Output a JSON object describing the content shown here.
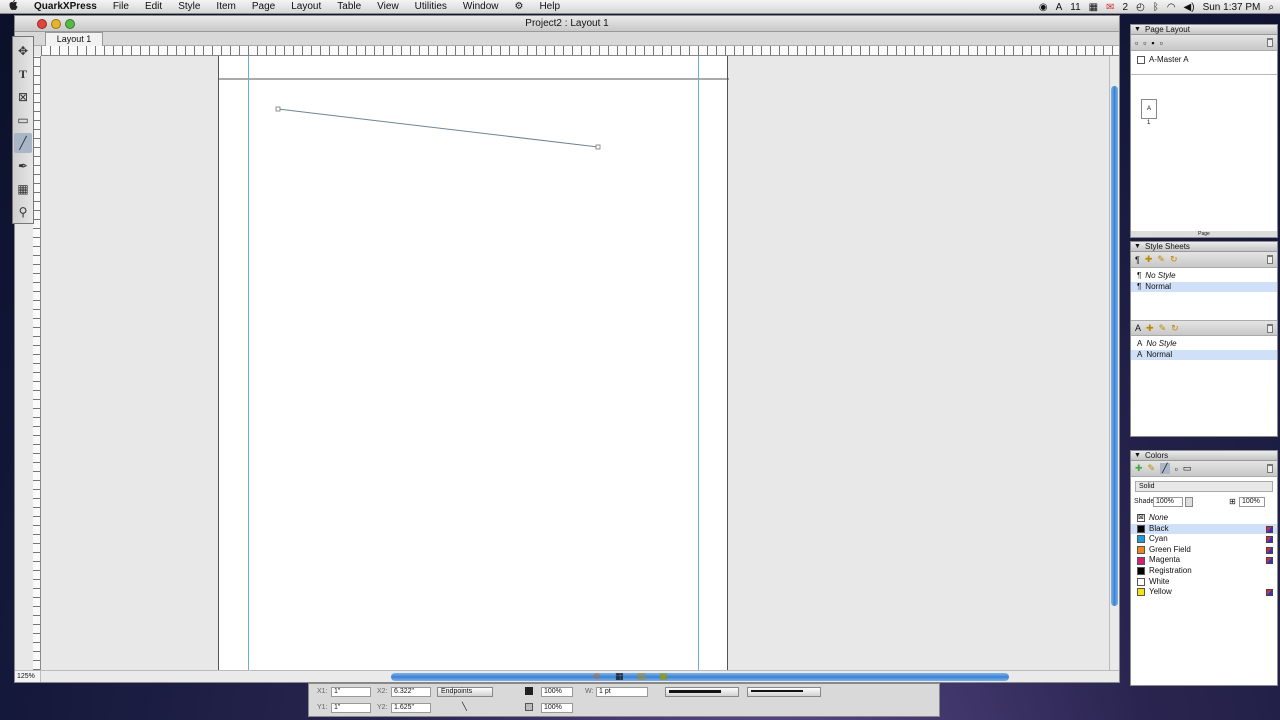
{
  "menubar": {
    "apple": "",
    "app": "QuarkXPress",
    "items": [
      "File",
      "Edit",
      "Style",
      "Item",
      "Page",
      "Layout",
      "Table",
      "View",
      "Utilities",
      "Window",
      "⚙",
      "Help"
    ],
    "status": {
      "count1": "11",
      "mail_count": "2",
      "clock": "Sun 1:37 PM"
    }
  },
  "window": {
    "title": "Project2 : Layout 1",
    "tab": "Layout 1",
    "zoom": "125%"
  },
  "tools": [
    "move-tool",
    "text-tool",
    "picture-tool",
    "rectangle-tool",
    "line-tool",
    "bezier-pen-tool",
    "table-tool",
    "zoom-tool"
  ],
  "measurements": {
    "x1_label": "X1:",
    "x1": "1\"",
    "y1_label": "Y1:",
    "y1": "1\"",
    "x2_label": "X2:",
    "x2": "6.322\"",
    "y2_label": "Y2:",
    "y2": "1.625\"",
    "mode": "Endpoints",
    "shade1": "100%",
    "shade2": "100%",
    "w_label": "W:",
    "width": "1 pt"
  },
  "page_layout": {
    "title": "Page Layout",
    "master": "A-Master A",
    "page_thumb": "A",
    "page_number": "1",
    "footer": "Page"
  },
  "style_sheets": {
    "title": "Style Sheets",
    "paragraph": [
      {
        "label": "No Style",
        "italic": true
      },
      {
        "label": "Normal",
        "selected": true
      }
    ],
    "character": [
      {
        "label": "No Style",
        "italic": true
      },
      {
        "label": "Normal",
        "selected": true
      }
    ]
  },
  "colors": {
    "title": "Colors",
    "mode": "Solid",
    "shade_label": "Shade:",
    "shade": "100%",
    "shade2": "100%",
    "items": [
      {
        "label": "None",
        "swatch": "none",
        "italic": true
      },
      {
        "label": "Black",
        "swatch": "#000000",
        "selected": true,
        "process": true
      },
      {
        "label": "Cyan",
        "swatch": "#1e9bd7",
        "process": true
      },
      {
        "label": "Green Field",
        "swatch": "#e8891f",
        "process": true
      },
      {
        "label": "Magenta",
        "swatch": "#d1207a",
        "process": true
      },
      {
        "label": "Registration",
        "swatch": "#000000"
      },
      {
        "label": "White",
        "swatch": "#ffffff"
      },
      {
        "label": "Yellow",
        "swatch": "#f2e60a",
        "process": true
      }
    ]
  }
}
